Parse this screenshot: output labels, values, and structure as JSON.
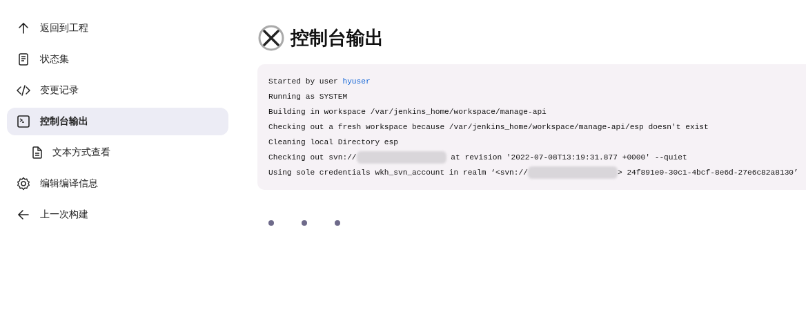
{
  "sidebar": {
    "items": [
      {
        "label": "返回到工程",
        "selected": false
      },
      {
        "label": "状态集",
        "selected": false
      },
      {
        "label": "变更记录",
        "selected": false
      },
      {
        "label": "控制台输出",
        "selected": true,
        "children": [
          {
            "label": "文本方式查看",
            "selected": false
          }
        ]
      },
      {
        "label": "编辑编译信息",
        "selected": false
      },
      {
        "label": "上一次构建",
        "selected": false
      }
    ]
  },
  "page": {
    "title": "控制台输出"
  },
  "console": {
    "lines": [
      [
        {
          "kind": "text",
          "text": "Started by user "
        },
        {
          "kind": "link",
          "text": "hyuser"
        }
      ],
      [
        {
          "kind": "text",
          "text": "Running as SYSTEM"
        }
      ],
      [
        {
          "kind": "text",
          "text": "Building in workspace /var/jenkins_home/workspace/manage-api"
        }
      ],
      [
        {
          "kind": "text",
          "text": "Checking out a fresh workspace because /var/jenkins_home/workspace/manage-api/esp doesn't exist"
        }
      ],
      [
        {
          "kind": "text",
          "text": "Cleaning local Directory esp"
        }
      ],
      [
        {
          "kind": "text",
          "text": "Checking out svn://"
        },
        {
          "kind": "redacted"
        },
        {
          "kind": "text",
          "text": " at revision '2022-07-08T13:19:31.877 +0000' --quiet"
        }
      ],
      [
        {
          "kind": "text",
          "text": "Using sole credentials wkh_svn_account in realm ‘<svn://"
        },
        {
          "kind": "redacted"
        },
        {
          "kind": "text",
          "text": "> 24f891e0-30c1-4bcf-8e6d-27e6c82a8130’"
        }
      ]
    ]
  }
}
